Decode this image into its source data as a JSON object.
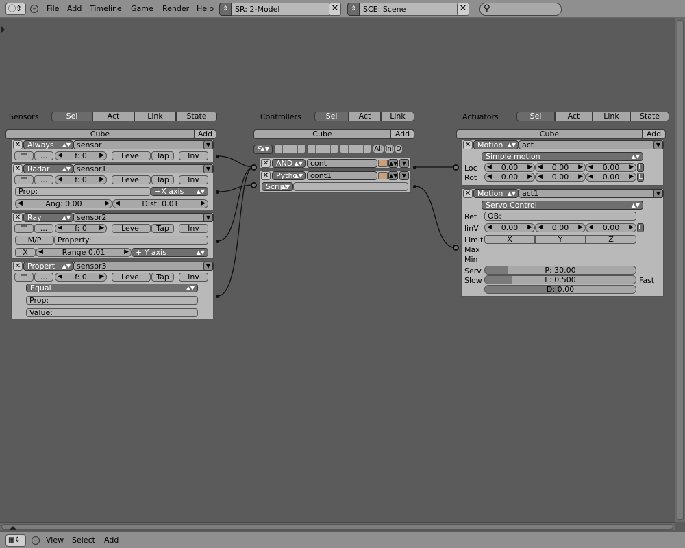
{
  "header": {
    "menu": [
      "File",
      "Add",
      "Timeline",
      "Game",
      "Render",
      "Help"
    ],
    "screen_field": "SR: 2-Model",
    "scene_field": "SCE: Scene",
    "search_placeholder": ""
  },
  "footer": {
    "menu": [
      "View",
      "Select",
      "Add"
    ]
  },
  "tabs": [
    "Sel",
    "Act",
    "Link",
    "State"
  ],
  "ctrl_tabs": [
    "Sel",
    "Act",
    "Link"
  ],
  "sections": {
    "sensors": "Sensors",
    "controllers": "Controllers",
    "actuators": "Actuators"
  },
  "object": {
    "name": "Cube",
    "add": "Add"
  },
  "sensors": [
    {
      "type": "Always",
      "name": "sensor",
      "pulse_a": "'''",
      "pulse_b": "...",
      "freq": "f: 0",
      "level": "Level",
      "tap": "Tap",
      "inv": "Inv"
    },
    {
      "type": "Radar",
      "name": "sensor1",
      "pulse_a": "'''",
      "pulse_b": "...",
      "freq": "f: 0",
      "level": "Level",
      "tap": "Tap",
      "inv": "Inv",
      "prop": "Prop:",
      "axis": "+X axis",
      "ang": "Ang: 0.00",
      "dist": "Dist: 0.01"
    },
    {
      "type": "Ray",
      "name": "sensor2",
      "pulse_a": "'''",
      "pulse_b": "...",
      "freq": "f: 0",
      "level": "Level",
      "tap": "Tap",
      "inv": "Inv",
      "mp": "M/P",
      "property": "Property:",
      "x": "X",
      "range": "Range 0.01",
      "axis": "+ Y axis"
    },
    {
      "type": "Propert",
      "name": "sensor3",
      "pulse_a": "'''",
      "pulse_b": "...",
      "freq": "f: 0",
      "level": "Level",
      "tap": "Tap",
      "inv": "Inv",
      "mode": "Equal",
      "prop": "Prop:",
      "value": "Value:"
    }
  ],
  "controllers": {
    "state_btn": "S",
    "all": "All",
    "ini": "Ini",
    "d": "D",
    "items": [
      {
        "type": "AND",
        "name": "cont"
      },
      {
        "type": "Pytho",
        "name": "cont1",
        "script_label": "Script"
      }
    ]
  },
  "actuators": [
    {
      "type": "Motion",
      "name": "act",
      "mode": "Simple motion",
      "loc_label": "Loc",
      "rot_label": "Rot",
      "loc": [
        "0.00",
        "0.00",
        "0.00"
      ],
      "rot": [
        "0.00",
        "0.00",
        "0.00"
      ],
      "l": "L"
    },
    {
      "type": "Motion",
      "name": "act1",
      "mode": "Servo Control",
      "ref_label": "Ref",
      "ref": "OB:",
      "linv_label": "linV",
      "linv": [
        "0.00",
        "0.00",
        "0.00"
      ],
      "limit_label": "Limit",
      "limit": [
        "X",
        "Y",
        "Z"
      ],
      "max_label": "Max",
      "min_label": "Min",
      "serv_label": "Serv",
      "slow_label": "Slow",
      "fast_label": "Fast",
      "p": "P: 30.00",
      "i": "I : 0.500",
      "d": "D: 0.00",
      "p_level": 0.15,
      "i_level": 0.18,
      "d_level": 0.5
    }
  ]
}
